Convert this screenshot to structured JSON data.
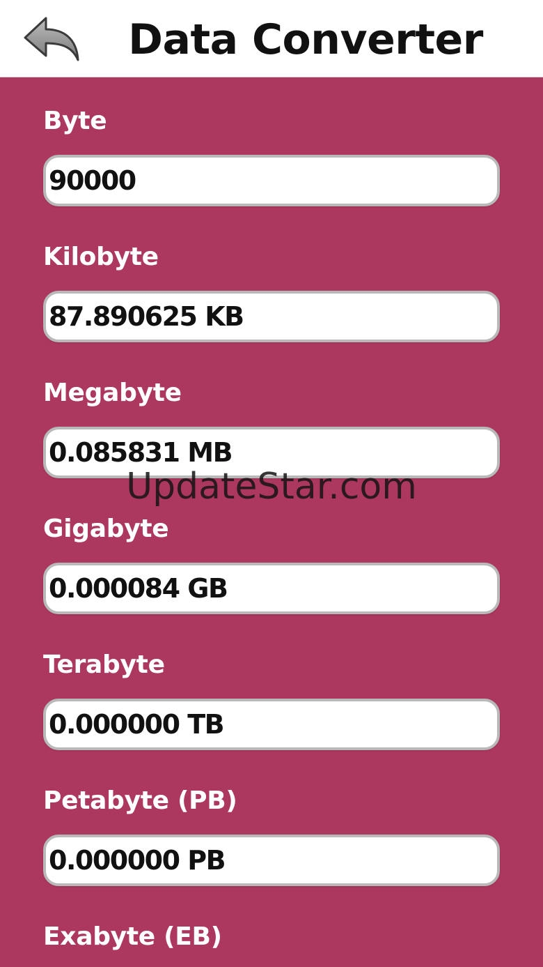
{
  "header": {
    "title": "Data Converter",
    "back_icon": "back-arrow-icon"
  },
  "fields": [
    {
      "label": "Byte",
      "value": "90000"
    },
    {
      "label": "Kilobyte",
      "value": "87.890625 KB"
    },
    {
      "label": "Megabyte",
      "value": "0.085831 MB"
    },
    {
      "label": "Gigabyte",
      "value": "0.000084 GB"
    },
    {
      "label": "Terabyte",
      "value": "0.000000 TB"
    },
    {
      "label": "Petabyte (PB)",
      "value": "0.000000 PB"
    },
    {
      "label": "Exabyte (EB)"
    }
  ],
  "watermark": "UpdateStar.com",
  "colors": {
    "background": "#ad385f",
    "header": "#ffffff",
    "input_border": "#b9b9b9",
    "label_text": "#ffffff"
  }
}
